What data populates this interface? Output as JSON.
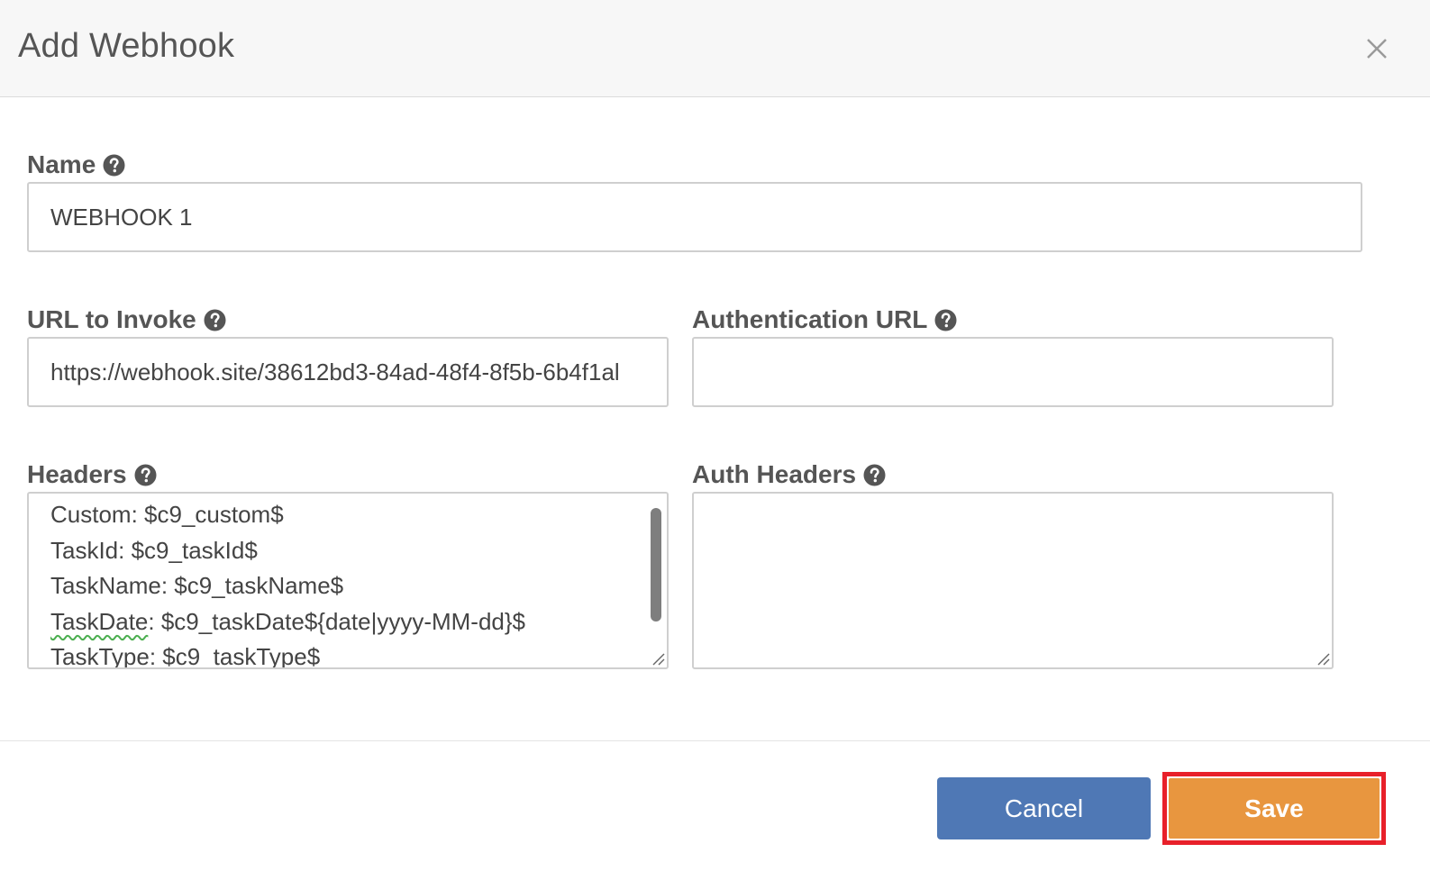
{
  "dialog": {
    "title": "Add Webhook",
    "close_icon": "close-icon"
  },
  "fields": {
    "name": {
      "label": "Name",
      "value": "WEBHOOK 1",
      "help_icon": "question-circle-icon"
    },
    "url_to_invoke": {
      "label": "URL to Invoke",
      "value": "https://webhook.site/38612bd3-84ad-48f4-8f5b-6b4f1al",
      "help_icon": "question-circle-icon"
    },
    "authentication_url": {
      "label": "Authentication URL",
      "value": "",
      "help_icon": "question-circle-icon"
    },
    "headers": {
      "label": "Headers",
      "lines": [
        "Custom: $c9_custom$",
        "TaskId: $c9_taskId$",
        "TaskName: $c9_taskName$",
        "TaskDate",
        ": $c9_taskDate${date|yyyy-MM-dd}$",
        "TaskType: $c9_taskType$"
      ],
      "help_icon": "question-circle-icon"
    },
    "auth_headers": {
      "label": "Auth Headers",
      "value": "",
      "help_icon": "question-circle-icon"
    }
  },
  "footer": {
    "cancel_label": "Cancel",
    "save_label": "Save"
  },
  "colors": {
    "cancel_button": "#4f78b5",
    "save_button": "#e8963f",
    "highlight_frame": "#e8202a"
  }
}
